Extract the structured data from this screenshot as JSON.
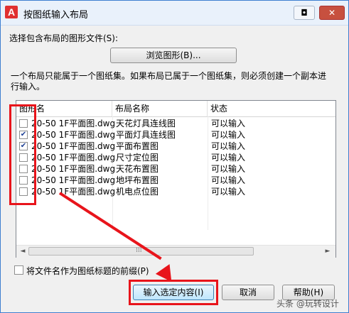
{
  "window": {
    "title": "按图纸输入布局",
    "help_icon": "◘",
    "close_icon": "✕",
    "app_icon_letter": "A"
  },
  "file_label": "选择包含布局的图形文件(S):",
  "browse_button": "浏览图形(B)...",
  "info_text_line1": "一个布局只能属于一个图纸集。如果布局已属于一个图纸集，则必须创建一个副本进",
  "info_text_line2": "行输入。",
  "table": {
    "headers": [
      "图形名",
      "布局名称",
      "状态"
    ],
    "rows": [
      {
        "checked": false,
        "file": "20-50 1F平面图.dwg",
        "layout": "天花灯具连线图",
        "status": "可以输入"
      },
      {
        "checked": true,
        "file": "20-50 1F平面图.dwg",
        "layout": "平面灯具连线图",
        "status": "可以输入"
      },
      {
        "checked": true,
        "file": "20-50 1F平面图.dwg",
        "layout": "平面布置图",
        "status": "可以输入"
      },
      {
        "checked": false,
        "file": "20-50 1F平面图.dwg",
        "layout": "尺寸定位图",
        "status": "可以输入"
      },
      {
        "checked": false,
        "file": "20-50 1F平面图.dwg",
        "layout": "天花布置图",
        "status": "可以输入"
      },
      {
        "checked": false,
        "file": "20-50 1F平面图.dwg",
        "layout": "地坪布置图",
        "status": "可以输入"
      },
      {
        "checked": false,
        "file": "20-50 1F平面图.dwg",
        "layout": "机电点位图",
        "status": "可以输入"
      }
    ],
    "scroll_left": "◄",
    "scroll_right": "►",
    "scroll_grip": "⁞⁞⁞"
  },
  "prefix_checkbox": {
    "checked": false,
    "label": "将文件名作为图纸标题的前缀(P)"
  },
  "buttons": {
    "import": "输入选定内容(I)",
    "cancel": "取消",
    "help": "帮助(H)"
  },
  "watermark": "头条 @玩转设计",
  "colors": {
    "annotation_red": "#e8141b",
    "accent_blue": "#3f7fd0"
  }
}
